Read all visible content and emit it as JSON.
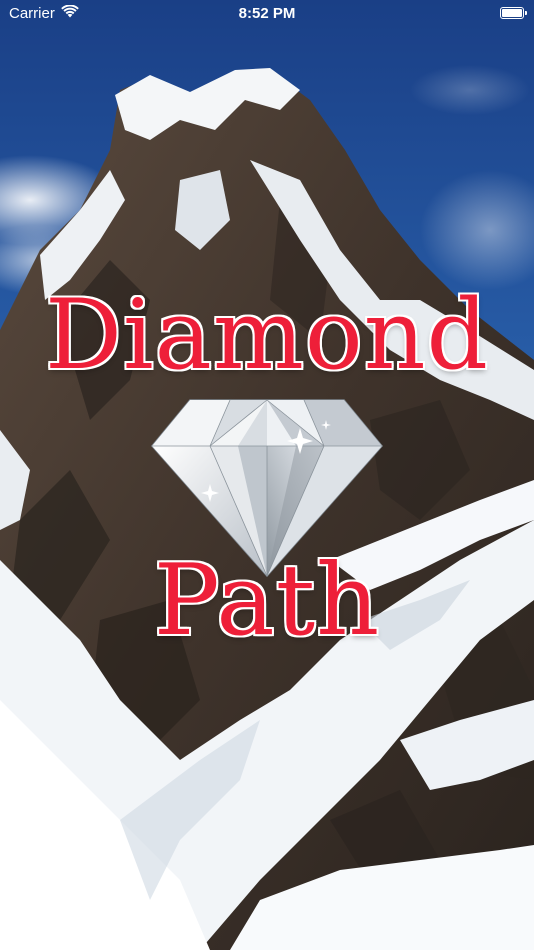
{
  "status_bar": {
    "carrier": "Carrier",
    "time": "8:52 PM",
    "wifi_icon": "wifi-icon",
    "battery_icon": "battery-icon",
    "battery_level": 1.0
  },
  "splash": {
    "title_line1": "Diamond",
    "title_line2": "Path",
    "logo_icon": "diamond-icon",
    "background": "snowy-mountain-peak"
  },
  "colors": {
    "title": "#ee1f39",
    "title_outline": "#ffffff",
    "sky": "#1f4f9a"
  }
}
